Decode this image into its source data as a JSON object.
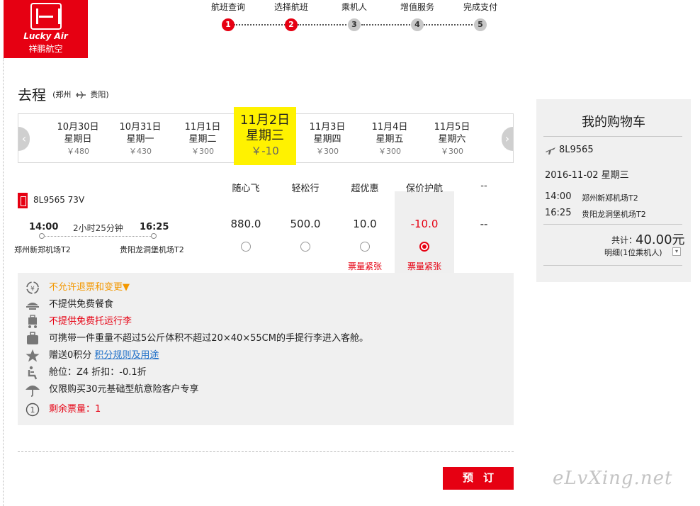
{
  "logo": {
    "en": "Lucky Air",
    "cn": "祥鹏航空"
  },
  "steps": [
    {
      "label": "航班查询",
      "num": "1",
      "active": true
    },
    {
      "label": "选择航班",
      "num": "2",
      "active": true
    },
    {
      "label": "乘机人",
      "num": "3",
      "active": false
    },
    {
      "label": "增值服务",
      "num": "4",
      "active": false
    },
    {
      "label": "完成支付",
      "num": "5",
      "active": false
    }
  ],
  "route": {
    "title": "去程",
    "from": "(郑州",
    "to": "贵阳)"
  },
  "dates": [
    {
      "date": "10月30日",
      "weekday": "星期日",
      "price": "￥480"
    },
    {
      "date": "10月31日",
      "weekday": "星期一",
      "price": "￥430"
    },
    {
      "date": "11月1日",
      "weekday": "星期二",
      "price": "￥300"
    },
    {
      "date": "11月2日",
      "weekday": "星期三",
      "price": "￥-10",
      "selected": true
    },
    {
      "date": "11月3日",
      "weekday": "星期四",
      "price": "￥300"
    },
    {
      "date": "11月4日",
      "weekday": "星期五",
      "price": "￥300"
    },
    {
      "date": "11月5日",
      "weekday": "星期六",
      "price": "￥300"
    }
  ],
  "fare_columns": [
    "随心飞",
    "轻松行",
    "超优惠",
    "保价护航",
    "--"
  ],
  "flight": {
    "number": "8L9565 73V",
    "dep_time": "14:00",
    "arr_time": "16:25",
    "duration": "2小时25分钟",
    "dep_airport": "郑州新郑机场T2",
    "arr_airport": "贵阳龙洞堡机场T2"
  },
  "prices": [
    "880.0",
    "500.0",
    "10.0",
    "-10.0",
    "--"
  ],
  "tight_label": "票量紧张",
  "details": {
    "refund": "不允许退票和变更▼",
    "meal": "不提供免费餐食",
    "baggage": "不提供免费托运行李",
    "carry_on": "可携带一件重量不超过5公斤体积不超过20×40×55CM的手提行李进入客舱。",
    "points": "赠送0积分",
    "points_link": "积分规则及用途",
    "cabin": "舱位：Z4   折扣：-0.1折",
    "insurance": "仅限购买30元基础型航意险客户专享",
    "remaining": "剩余票量：1"
  },
  "book_label": "预订",
  "cart": {
    "title": "我的购物车",
    "flight": "8L9565",
    "date": "2016-11-02  星期三",
    "dep_time": "14:00",
    "dep_airport": "郑州新郑机场T2",
    "arr_time": "16:25",
    "arr_airport": "贵阳龙洞堡机场T2",
    "total_label": "共计：",
    "total": "40.00元",
    "detail": "明细(1位乘机人)"
  },
  "watermark": "eLvXing.net",
  "colors": {
    "brand_red": "#e60012",
    "highlight_yellow": "#fff200",
    "link_blue": "#1e6fc8",
    "warn_orange": "#f39800"
  }
}
